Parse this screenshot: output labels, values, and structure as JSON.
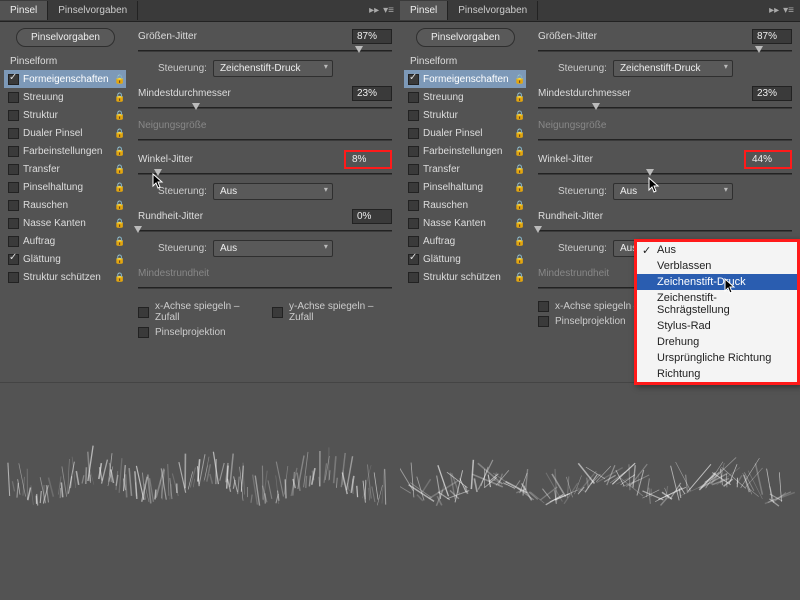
{
  "tabs": {
    "left": "Pinsel",
    "right": "Pinselvorgaben"
  },
  "sidebar": {
    "preset_btn": "Pinselvorgaben",
    "cat": "Pinselform",
    "items": [
      {
        "label": "Formeigenschaften",
        "checked": true,
        "sel": true,
        "lock": true
      },
      {
        "label": "Streuung",
        "checked": false,
        "lock": true
      },
      {
        "label": "Struktur",
        "checked": false,
        "lock": true
      },
      {
        "label": "Dualer Pinsel",
        "checked": false,
        "lock": true
      },
      {
        "label": "Farbeinstellungen",
        "checked": false,
        "lock": true
      },
      {
        "label": "Transfer",
        "checked": false,
        "lock": true
      },
      {
        "label": "Pinselhaltung",
        "checked": false,
        "lock": true
      },
      {
        "label": "Rauschen",
        "checked": false,
        "lock": true
      },
      {
        "label": "Nasse Kanten",
        "checked": false,
        "lock": true
      },
      {
        "label": "Auftrag",
        "checked": false,
        "lock": true
      },
      {
        "label": "Glättung",
        "checked": true,
        "lock": true
      },
      {
        "label": "Struktur schützen",
        "checked": false,
        "lock": true
      }
    ]
  },
  "controls": {
    "size_jitter": "Größen-Jitter",
    "steuerung": "Steuerung:",
    "zeichenstift": "Zeichenstift-Druck",
    "min_diam": "Mindestdurchmesser",
    "tilt": "Neigungsgröße",
    "angle_jitter": "Winkel-Jitter",
    "aus": "Aus",
    "round_jitter": "Rundheit-Jitter",
    "min_round": "Mindestrundheit",
    "flipx": "x-Achse spiegeln – Zufall",
    "flipy": "y-Achse spiegeln – Zufall",
    "proj": "Pinselprojektion"
  },
  "left": {
    "size_jitter_val": "87%",
    "min_diam_val": "23%",
    "angle_jitter_val": "8%",
    "round_jitter_val": "0%"
  },
  "right": {
    "size_jitter_val": "87%",
    "min_diam_val": "23%",
    "angle_jitter_val": "44%"
  },
  "menu": {
    "items": [
      {
        "label": "Aus",
        "checked": true
      },
      {
        "label": "Verblassen"
      },
      {
        "label": "Zeichenstift-Druck",
        "hl": true
      },
      {
        "label": "Zeichenstift-Schrägstellung"
      },
      {
        "label": "Stylus-Rad"
      },
      {
        "label": "Drehung"
      },
      {
        "label": "Ursprüngliche Richtung"
      },
      {
        "label": "Richtung"
      }
    ]
  }
}
